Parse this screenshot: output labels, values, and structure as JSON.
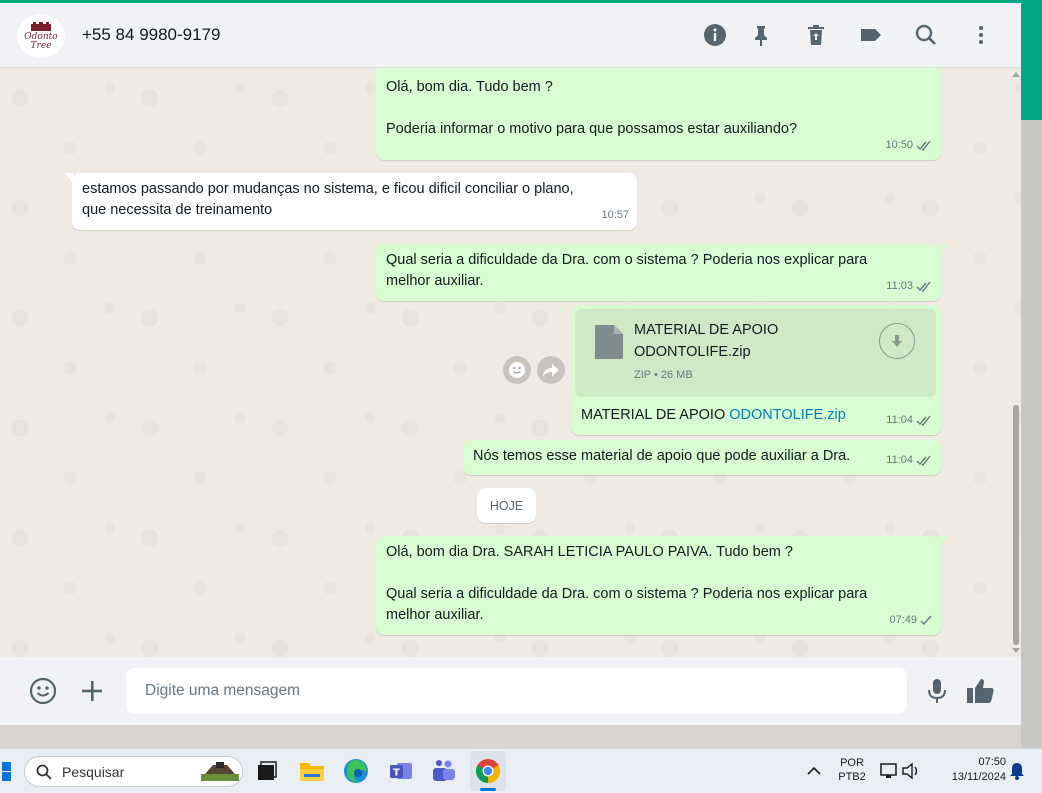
{
  "header": {
    "avatar_text_1": "Odonto",
    "avatar_text_2": "Tree",
    "contact_name": "+55 84 9980-9179"
  },
  "messages": [
    {
      "id": "m1",
      "direction": "out",
      "text": "Olá, bom dia. Tudo bem ?\n\nPoderia informar o motivo para que possamos estar auxiliando?",
      "time": "10:50",
      "status": "read"
    },
    {
      "id": "m2",
      "direction": "in",
      "text": "estamos passando por mudanças no sistema, e ficou dificil conciliar o plano,\nque necessita de treinamento",
      "time": "10:57"
    },
    {
      "id": "m3",
      "direction": "out",
      "text": "Qual seria a dificuldade da Dra. com o sistema ? Poderia nos explicar para\nmelhor auxiliar.",
      "time": "11:03",
      "status": "read"
    },
    {
      "id": "m4",
      "direction": "out",
      "type": "file",
      "file_name": "MATERIAL DE APOIO ODONTOLIFE.zip",
      "file_meta": "ZIP • 26 MB",
      "caption_prefix": "MATERIAL DE APOIO ",
      "caption_link": "ODONTOLIFE.zip",
      "time": "11:04",
      "status": "read"
    },
    {
      "id": "m5",
      "direction": "out",
      "text": "Nós temos esse material de apoio que pode auxiliar a Dra.",
      "time": "11:04",
      "status": "read"
    },
    {
      "id": "m6",
      "direction": "out",
      "text": "Olá, bom dia Dra. SARAH LETICIA PAULO PAIVA. Tudo bem ?\n\nQual seria a dificuldade da Dra. com o sistema ? Poderia nos explicar para\nmelhor auxiliar.",
      "time": "07:49",
      "status": "sent"
    }
  ],
  "date_divider": "HOJE",
  "footer": {
    "placeholder": "Digite uma mensagem"
  },
  "taskbar": {
    "search_label": "Pesquisar",
    "lang_1": "POR",
    "lang_2": "PTB2",
    "time": "07:50",
    "date": "13/11/2024"
  },
  "colors": {
    "accent": "#00a884",
    "outgoing_bubble": "#d9fdd3",
    "incoming_bubble": "#ffffff",
    "read_ticks": "#667781",
    "link": "#027eb5"
  },
  "icons": {
    "header": [
      "info-icon",
      "pin-icon",
      "delete-icon",
      "label-icon",
      "search-icon",
      "menu-icon"
    ],
    "footer": [
      "emoji-icon",
      "plus-icon",
      "mic-icon",
      "thumbs-up-icon"
    ]
  }
}
